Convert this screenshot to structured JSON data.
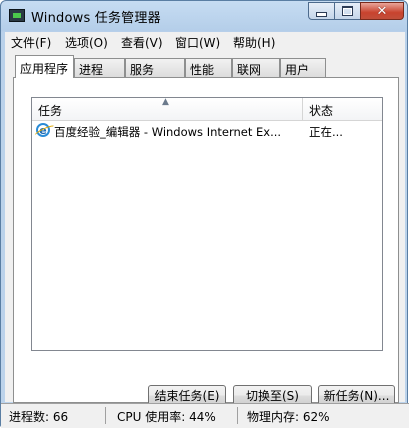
{
  "window": {
    "title": "Windows 任务管理器"
  },
  "menu": [
    "文件(F)",
    "选项(O)",
    "查看(V)",
    "窗口(W)",
    "帮助(H)"
  ],
  "tabs": [
    "应用程序",
    "进程",
    "服务",
    "性能",
    "联网",
    "用户"
  ],
  "active_tab": "应用程序",
  "list": {
    "columns": [
      "任务",
      "状态"
    ],
    "rows": [
      {
        "task": "百度经验_编辑器 - Windows Internet Ex...",
        "status": "正在..."
      }
    ]
  },
  "buttons": {
    "end_task": "结束任务(E)",
    "switch_to": "切换至(S)",
    "new_task": "新任务(N)..."
  },
  "status": {
    "processes": "进程数: 66",
    "cpu": "CPU 使用率: 44%",
    "memory": "物理内存: 62%"
  }
}
